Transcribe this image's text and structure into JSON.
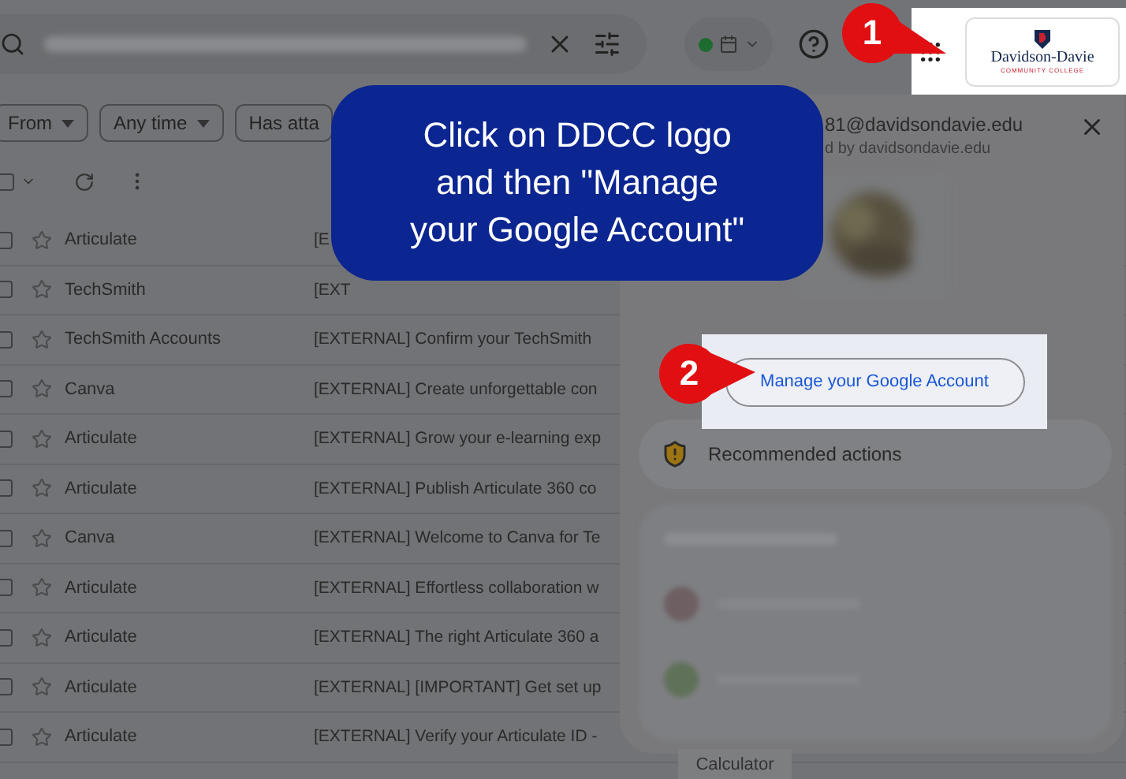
{
  "filters": [
    {
      "label": "From",
      "dropdown": true
    },
    {
      "label": "Any time",
      "dropdown": true
    },
    {
      "label": "Has atta",
      "dropdown": false
    }
  ],
  "emails": [
    {
      "sender": "Articulate",
      "subject": "[E",
      "checked": false
    },
    {
      "sender": "TechSmith",
      "subject": "[EXT",
      "checked": false
    },
    {
      "sender": "TechSmith Accounts",
      "subject": "[EXTERNAL] Confirm your TechSmith",
      "checked": false
    },
    {
      "sender": "Canva",
      "subject": "[EXTERNAL] Create unforgettable con",
      "checked": false
    },
    {
      "sender": "Articulate",
      "subject": "[EXTERNAL] Grow your e-learning exp",
      "checked": false
    },
    {
      "sender": "Articulate",
      "subject": "[EXTERNAL] Publish Articulate 360 co",
      "checked": false
    },
    {
      "sender": "Canva",
      "subject": "[EXTERNAL] Welcome to Canva for Te",
      "checked": false
    },
    {
      "sender": "Articulate",
      "subject": "[EXTERNAL] Effortless collaboration w",
      "checked": false
    },
    {
      "sender": "Articulate",
      "subject": "[EXTERNAL] The right Articulate 360 a",
      "checked": false
    },
    {
      "sender": "Articulate",
      "subject": "[EXTERNAL] [IMPORTANT] Get set up",
      "checked": false
    },
    {
      "sender": "Articulate",
      "subject": "[EXTERNAL] Verify your Articulate ID -",
      "checked": false
    }
  ],
  "logo": {
    "name": "Davidson-Davie",
    "tagline": "COMMUNITY COLLEGE"
  },
  "account_panel": {
    "email": "81@davidsondavie.edu",
    "managed_by": "d by davidsondavie.edu",
    "manage_button": "Manage your Google Account",
    "recommended": "Recommended actions"
  },
  "tooltip": "Calculator",
  "callout": {
    "lines": [
      "Click on DDCC logo",
      "and then \"Manage",
      "your Google Account\""
    ]
  },
  "steps": [
    "1",
    "2"
  ],
  "select_all": {
    "checked": false
  }
}
